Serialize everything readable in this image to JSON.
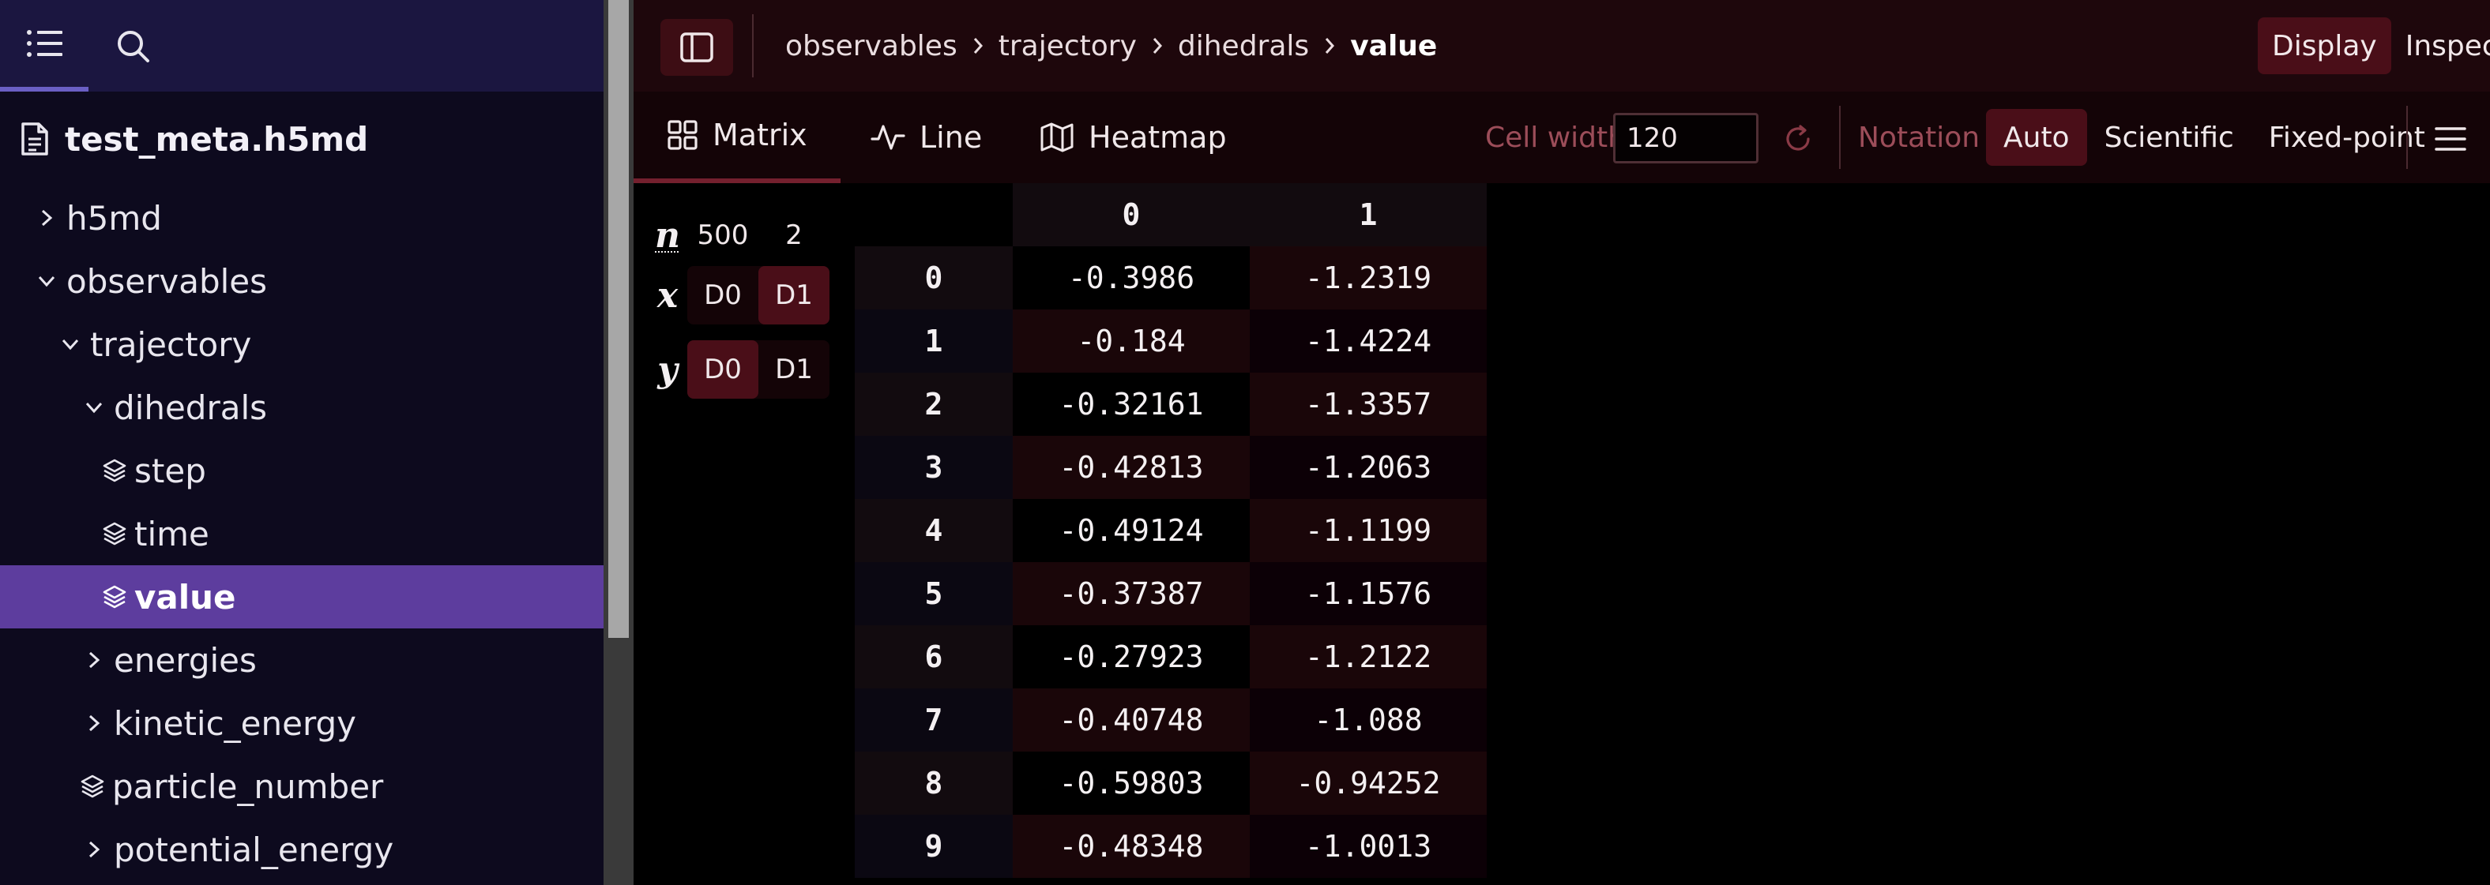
{
  "sidebar": {
    "file_name": "test_meta.h5md",
    "tree": [
      {
        "label": "h5md",
        "kind": "group",
        "expanded": false
      },
      {
        "label": "observables",
        "kind": "group",
        "expanded": true
      },
      {
        "label": "trajectory",
        "kind": "group",
        "expanded": true
      },
      {
        "label": "dihedrals",
        "kind": "group",
        "expanded": true
      },
      {
        "label": "step",
        "kind": "dataset"
      },
      {
        "label": "time",
        "kind": "dataset"
      },
      {
        "label": "value",
        "kind": "dataset",
        "selected": true
      },
      {
        "label": "energies",
        "kind": "group",
        "expanded": false
      },
      {
        "label": "kinetic_energy",
        "kind": "group",
        "expanded": false
      },
      {
        "label": "particle_number",
        "kind": "dataset"
      },
      {
        "label": "potential_energy",
        "kind": "group",
        "expanded": false
      }
    ]
  },
  "breadcrumb": [
    "observables",
    "trajectory",
    "dihedrals",
    "value"
  ],
  "mode": {
    "display": "Display",
    "inspect": "Inspect",
    "active": "Display"
  },
  "vis_tabs": {
    "matrix": "Matrix",
    "line": "Line",
    "heatmap": "Heatmap"
  },
  "toolbar": {
    "cell_width_label": "Cell width",
    "cell_width_value": "120",
    "notation_label": "Notation",
    "notation_options": [
      "Auto",
      "Scientific",
      "Fixed-point"
    ],
    "notation_active": "Auto"
  },
  "dim_mapper": {
    "n_label": "n",
    "x_label": "x",
    "y_label": "y",
    "dims": [
      "500",
      "2"
    ],
    "x_options": [
      "D0",
      "D1"
    ],
    "y_options": [
      "D0",
      "D1"
    ],
    "x_active": "D1",
    "y_active": "D0"
  },
  "matrix": {
    "columns": [
      "0",
      "1"
    ],
    "rows": [
      {
        "index": "0",
        "values": [
          "-0.3986",
          "-1.2319"
        ]
      },
      {
        "index": "1",
        "values": [
          "-0.184",
          "-1.4224"
        ]
      },
      {
        "index": "2",
        "values": [
          "-0.32161",
          "-1.3357"
        ]
      },
      {
        "index": "3",
        "values": [
          "-0.42813",
          "-1.2063"
        ]
      },
      {
        "index": "4",
        "values": [
          "-0.49124",
          "-1.1199"
        ]
      },
      {
        "index": "5",
        "values": [
          "-0.37387",
          "-1.1576"
        ]
      },
      {
        "index": "6",
        "values": [
          "-0.27923",
          "-1.2122"
        ]
      },
      {
        "index": "7",
        "values": [
          "-0.40748",
          "-1.088"
        ]
      },
      {
        "index": "8",
        "values": [
          "-0.59803",
          "-0.94252"
        ]
      },
      {
        "index": "9",
        "values": [
          "-0.48348",
          "-1.0013"
        ]
      }
    ]
  },
  "colors": {
    "sidebar_bg": "#0d0a1e",
    "sidebar_toolbar": "#1b1640",
    "tree_selected": "#5d3d9e",
    "accent": "#4a0e18",
    "muted_label": "#9c4d59"
  }
}
